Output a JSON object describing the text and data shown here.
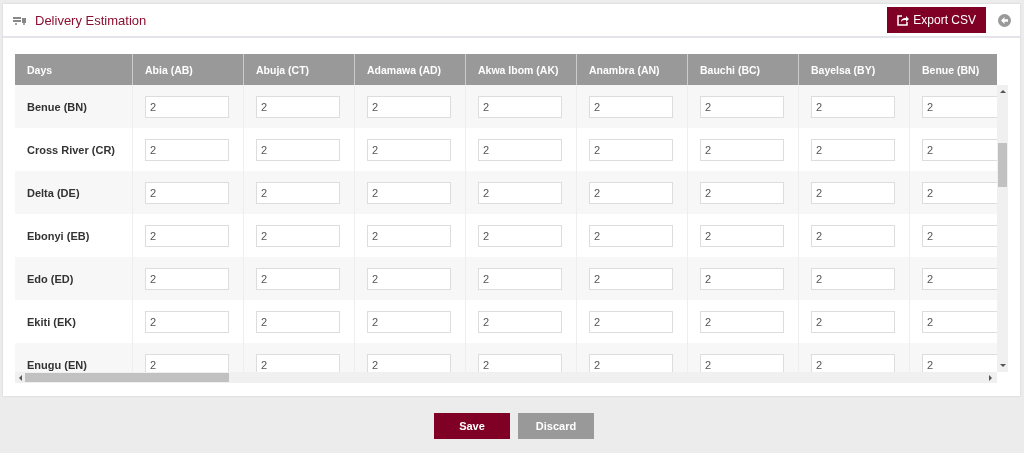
{
  "header": {
    "title": "Delivery Estimation",
    "export_button": "Export CSV"
  },
  "table": {
    "columns": [
      "Days",
      "Abia (AB)",
      "Abuja (CT)",
      "Adamawa (AD)",
      "Akwa Ibom (AK)",
      "Anambra (AN)",
      "Bauchi (BC)",
      "Bayelsa (BY)",
      "Benue (BN)"
    ],
    "rows": [
      {
        "label": "Benue (BN)",
        "values": [
          "2",
          "2",
          "2",
          "2",
          "2",
          "2",
          "2",
          "2"
        ]
      },
      {
        "label": "Cross River (CR)",
        "values": [
          "2",
          "2",
          "2",
          "2",
          "2",
          "2",
          "2",
          "2"
        ]
      },
      {
        "label": "Delta (DE)",
        "values": [
          "2",
          "2",
          "2",
          "2",
          "2",
          "2",
          "2",
          "2"
        ]
      },
      {
        "label": "Ebonyi (EB)",
        "values": [
          "2",
          "2",
          "2",
          "2",
          "2",
          "2",
          "2",
          "2"
        ]
      },
      {
        "label": "Edo (ED)",
        "values": [
          "2",
          "2",
          "2",
          "2",
          "2",
          "2",
          "2",
          "2"
        ]
      },
      {
        "label": "Ekiti (EK)",
        "values": [
          "2",
          "2",
          "2",
          "2",
          "2",
          "2",
          "2",
          "2"
        ]
      },
      {
        "label": "Enugu (EN)",
        "values": [
          "2",
          "2",
          "2",
          "2",
          "2",
          "2",
          "2",
          "2"
        ]
      }
    ]
  },
  "buttons": {
    "save": "Save",
    "discard": "Discard"
  }
}
